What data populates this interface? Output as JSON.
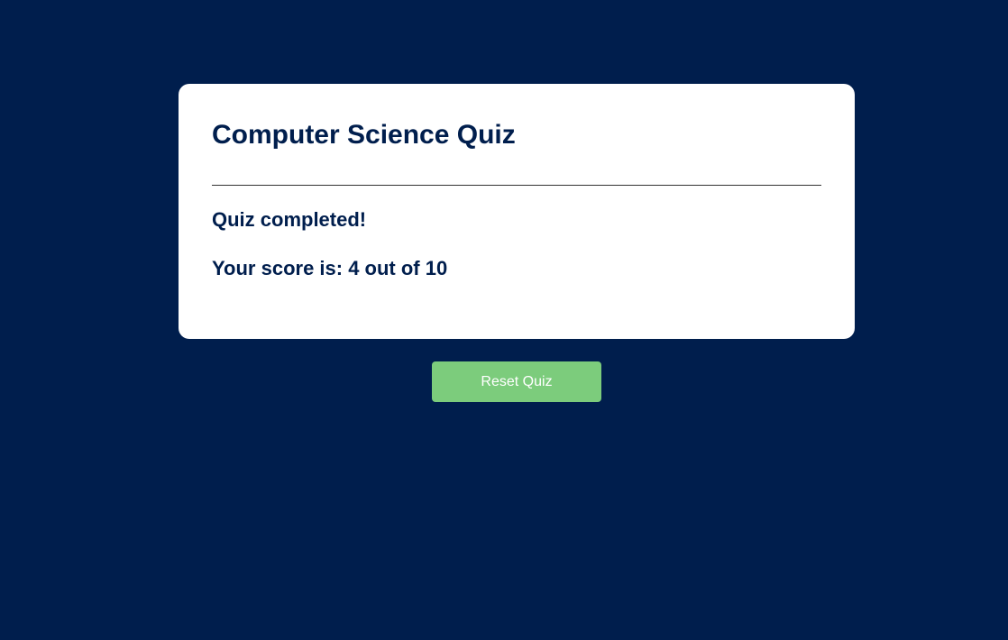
{
  "quiz": {
    "title": "Computer Science Quiz",
    "status": "Quiz completed!",
    "score_text": "Your score is: 4 out of 10",
    "score": 4,
    "total": 10
  },
  "actions": {
    "reset_label": "Reset Quiz"
  },
  "colors": {
    "background": "#001e4d",
    "card": "#ffffff",
    "text": "#001e4d",
    "button": "#7ccc7c",
    "button_text": "#ffffff"
  }
}
